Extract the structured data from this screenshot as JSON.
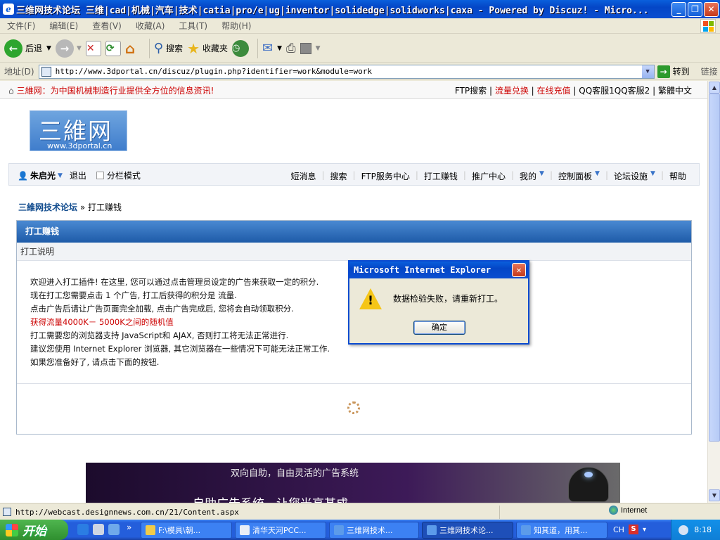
{
  "window": {
    "title": "三维网技术论坛 三维|cad|机械|汽车|技术|catia|pro/e|ug|inventor|solidedge|solidworks|caxa - Powered by Discuz! - Micro..."
  },
  "menu": [
    "文件(F)",
    "编辑(E)",
    "查看(V)",
    "收藏(A)",
    "工具(T)",
    "帮助(H)"
  ],
  "toolbar": {
    "back": "后退",
    "search": "搜索",
    "favorites": "收藏夹"
  },
  "address": {
    "label": "地址(D)",
    "url": "http://www.3dportal.cn/discuz/plugin.php?identifier=work&module=work",
    "go": "转到",
    "links": "链接"
  },
  "site": {
    "slogan": "三維网：为中国机械制造行业提供全方位的信息资讯!",
    "toplinks": {
      "ftp": "FTP搜索",
      "sep": "|",
      "flow": "流量兑换",
      "recharge": "在线充值",
      "rest": "QQ客服1QQ客服2 | 繁體中文"
    },
    "logo": {
      "cn": "三維网",
      "en": "www.3dportal.cn"
    },
    "user": "朱启光",
    "logout": "退出",
    "columns": "分栏模式",
    "nav": [
      "短消息",
      "搜索",
      "FTP服务中心",
      "打工赚钱",
      "推广中心",
      "我的",
      "控制面板",
      "论坛设施",
      "帮助"
    ],
    "crumb": {
      "home": "三維网技术论坛",
      "sep": "»",
      "current": "打工赚钱"
    },
    "box": {
      "title": "打工赚钱",
      "sub": "打工说明",
      "lines": [
        "欢迎进入打工插件! 在这里, 您可以通过点击管理员设定的广告来获取一定的积分.",
        "现在打工您需要点击  1 个广告, 打工后获得的积分是  流量.",
        "点击广告后请让广告页面完全加载, 点击广告完成后, 您将会自动领取积分.",
        "获得流量4000K－ 5000K之间的随机值",
        "打工需要您的浏览器支持  JavaScript和  AJAX, 否则打工将无法正常进行.",
        "建议您使用  Internet Explorer 浏览器, 其它浏览器在一些情况下可能无法正常工作.",
        "如果您准备好了, 请点击下面的按钮."
      ]
    },
    "ad": {
      "line1": "双向自助，自由灵活的广告系统",
      "line2": "自助广告系统，让您光高甚成"
    }
  },
  "dialog": {
    "title": "Microsoft Internet Explorer",
    "message": "数据检验失败，请重新打工。",
    "ok": "确定"
  },
  "status": {
    "text": "http://webcast.designnews.com.cn/21/Content.aspx",
    "zone": "Internet"
  },
  "taskbar": {
    "start": "开始",
    "tasks": [
      "F:\\模具\\朝...",
      "清华天河PCC...",
      "三维网技术...",
      "三维网技术论...",
      "知其道，用其..."
    ],
    "lang": "CH",
    "time": "8:18"
  }
}
